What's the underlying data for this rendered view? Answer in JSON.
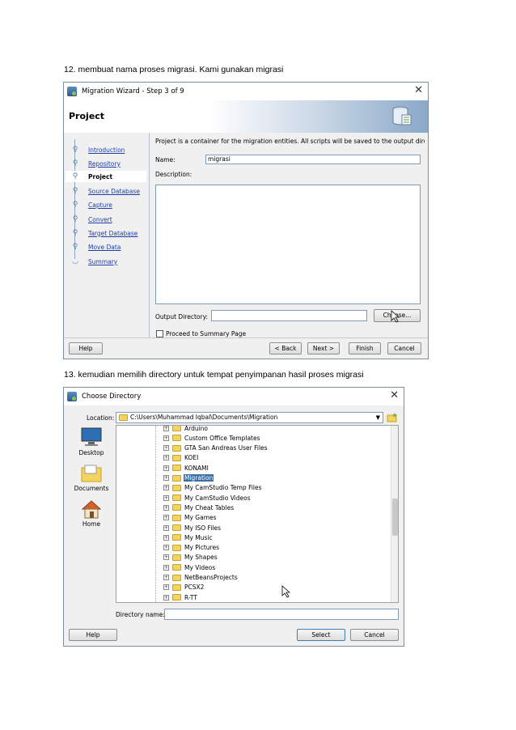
{
  "captions": {
    "step12": "12. membuat nama proses migrasi. Kami gunakan migrasi",
    "step13": "13. kemudian memilih directory untuk tempat penyimpanan hasil proses migrasi"
  },
  "wizard": {
    "title": "Migration Wizard - Step 3 of 9",
    "close": "✕",
    "banner_title": "Project",
    "steps": [
      "Introduction",
      "Repository",
      "Project",
      "Source Database",
      "Capture ",
      "Convert",
      "Target Database",
      "Move Data",
      "Summary"
    ],
    "current_step": 2,
    "description_text": "Project is a container for the migration entities.  All scripts will be saved to the output direct...",
    "name_label": "Name:",
    "name_value": "migrasi",
    "description_label": "Description:",
    "output_label": "Output Directory:",
    "output_value": "",
    "choose_button": "Choose...",
    "proceed_label": "Proceed to Summary Page",
    "buttons": {
      "help": "Help",
      "back": "< Back",
      "next": "Next >",
      "finish": "Finish",
      "cancel": "Cancel"
    }
  },
  "chooser": {
    "title": "Choose Directory",
    "close": "✕",
    "location_label": "Location:",
    "location_value": "C:\\Users\\Muhammad Iqbal\\Documents\\Migration",
    "places": [
      "Desktop",
      "Documents",
      "Home"
    ],
    "folders": [
      "Arduino",
      "Custom Office Templates",
      "GTA San Andreas User Files",
      "KOEI",
      "KONAMI",
      "Migration",
      "My CamStudio Temp Files",
      "My CamStudio Videos",
      "My Cheat Tables",
      "My Games",
      "My ISO Files",
      "My Music",
      "My Pictures",
      "My Shapes",
      "My Videos",
      "NetBeansProjects",
      "PCSX2",
      "R-TT"
    ],
    "selected_folder_index": 5,
    "dirname_label": "Directory name:",
    "dirname_value": "",
    "buttons": {
      "help": "Help",
      "select": "Select",
      "cancel": "Cancel"
    }
  }
}
